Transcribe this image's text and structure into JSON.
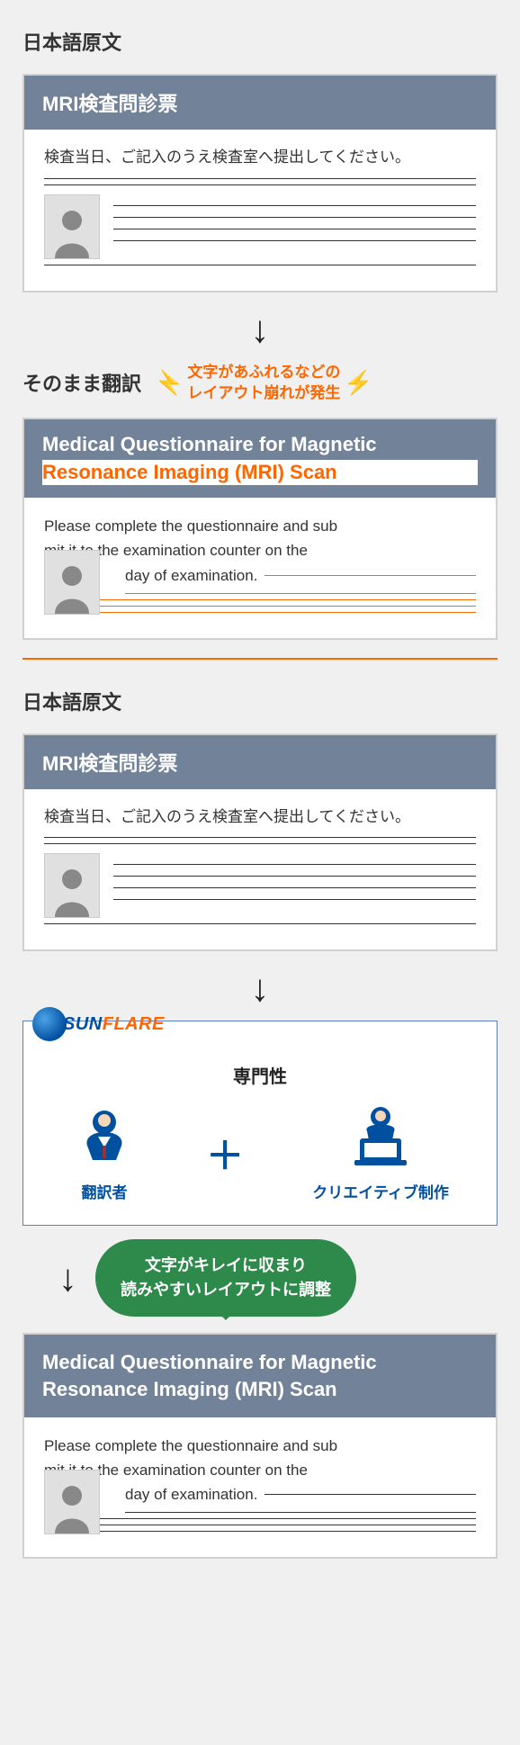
{
  "section1": {
    "title": "日本語原文",
    "card": {
      "header": "MRI検査問診票",
      "text": "検査当日、ご記入のうえ検査室へ提出してください。"
    }
  },
  "direct": {
    "label": "そのまま翻訳",
    "warning_l1": "文字があふれるなどの",
    "warning_l2": "レイアウト崩れが発生"
  },
  "badcard": {
    "header_l1": "Medical Questionnaire for Magnetic",
    "header_l2": "Resonance Imaging (MRI) Scan",
    "body_l1": "Please complete the questionnaire and sub",
    "body_l2": "mit it to the examination counter on the",
    "body_l3": "day of examination."
  },
  "section2": {
    "title": "日本語原文",
    "card": {
      "header": "MRI検査問診票",
      "text": "検査当日、ご記入のうえ検査室へ提出してください。"
    }
  },
  "sunflare": {
    "logo_sun": "SUN",
    "logo_flare": "FLARE",
    "subtitle": "専門性",
    "translator": "翻訳者",
    "plus": "＋",
    "creative": "クリエイティブ制作"
  },
  "bubble": {
    "l1": "文字がキレイに収まり",
    "l2": "読みやすいレイアウトに調整"
  },
  "goodcard": {
    "header_l1": "Medical Questionnaire for Magnetic",
    "header_l2": "Resonance Imaging (MRI) Scan",
    "body_l1": "Please complete the questionnaire and sub",
    "body_l2": "mit it to the examination counter on the",
    "body_l3": "day of examination."
  }
}
